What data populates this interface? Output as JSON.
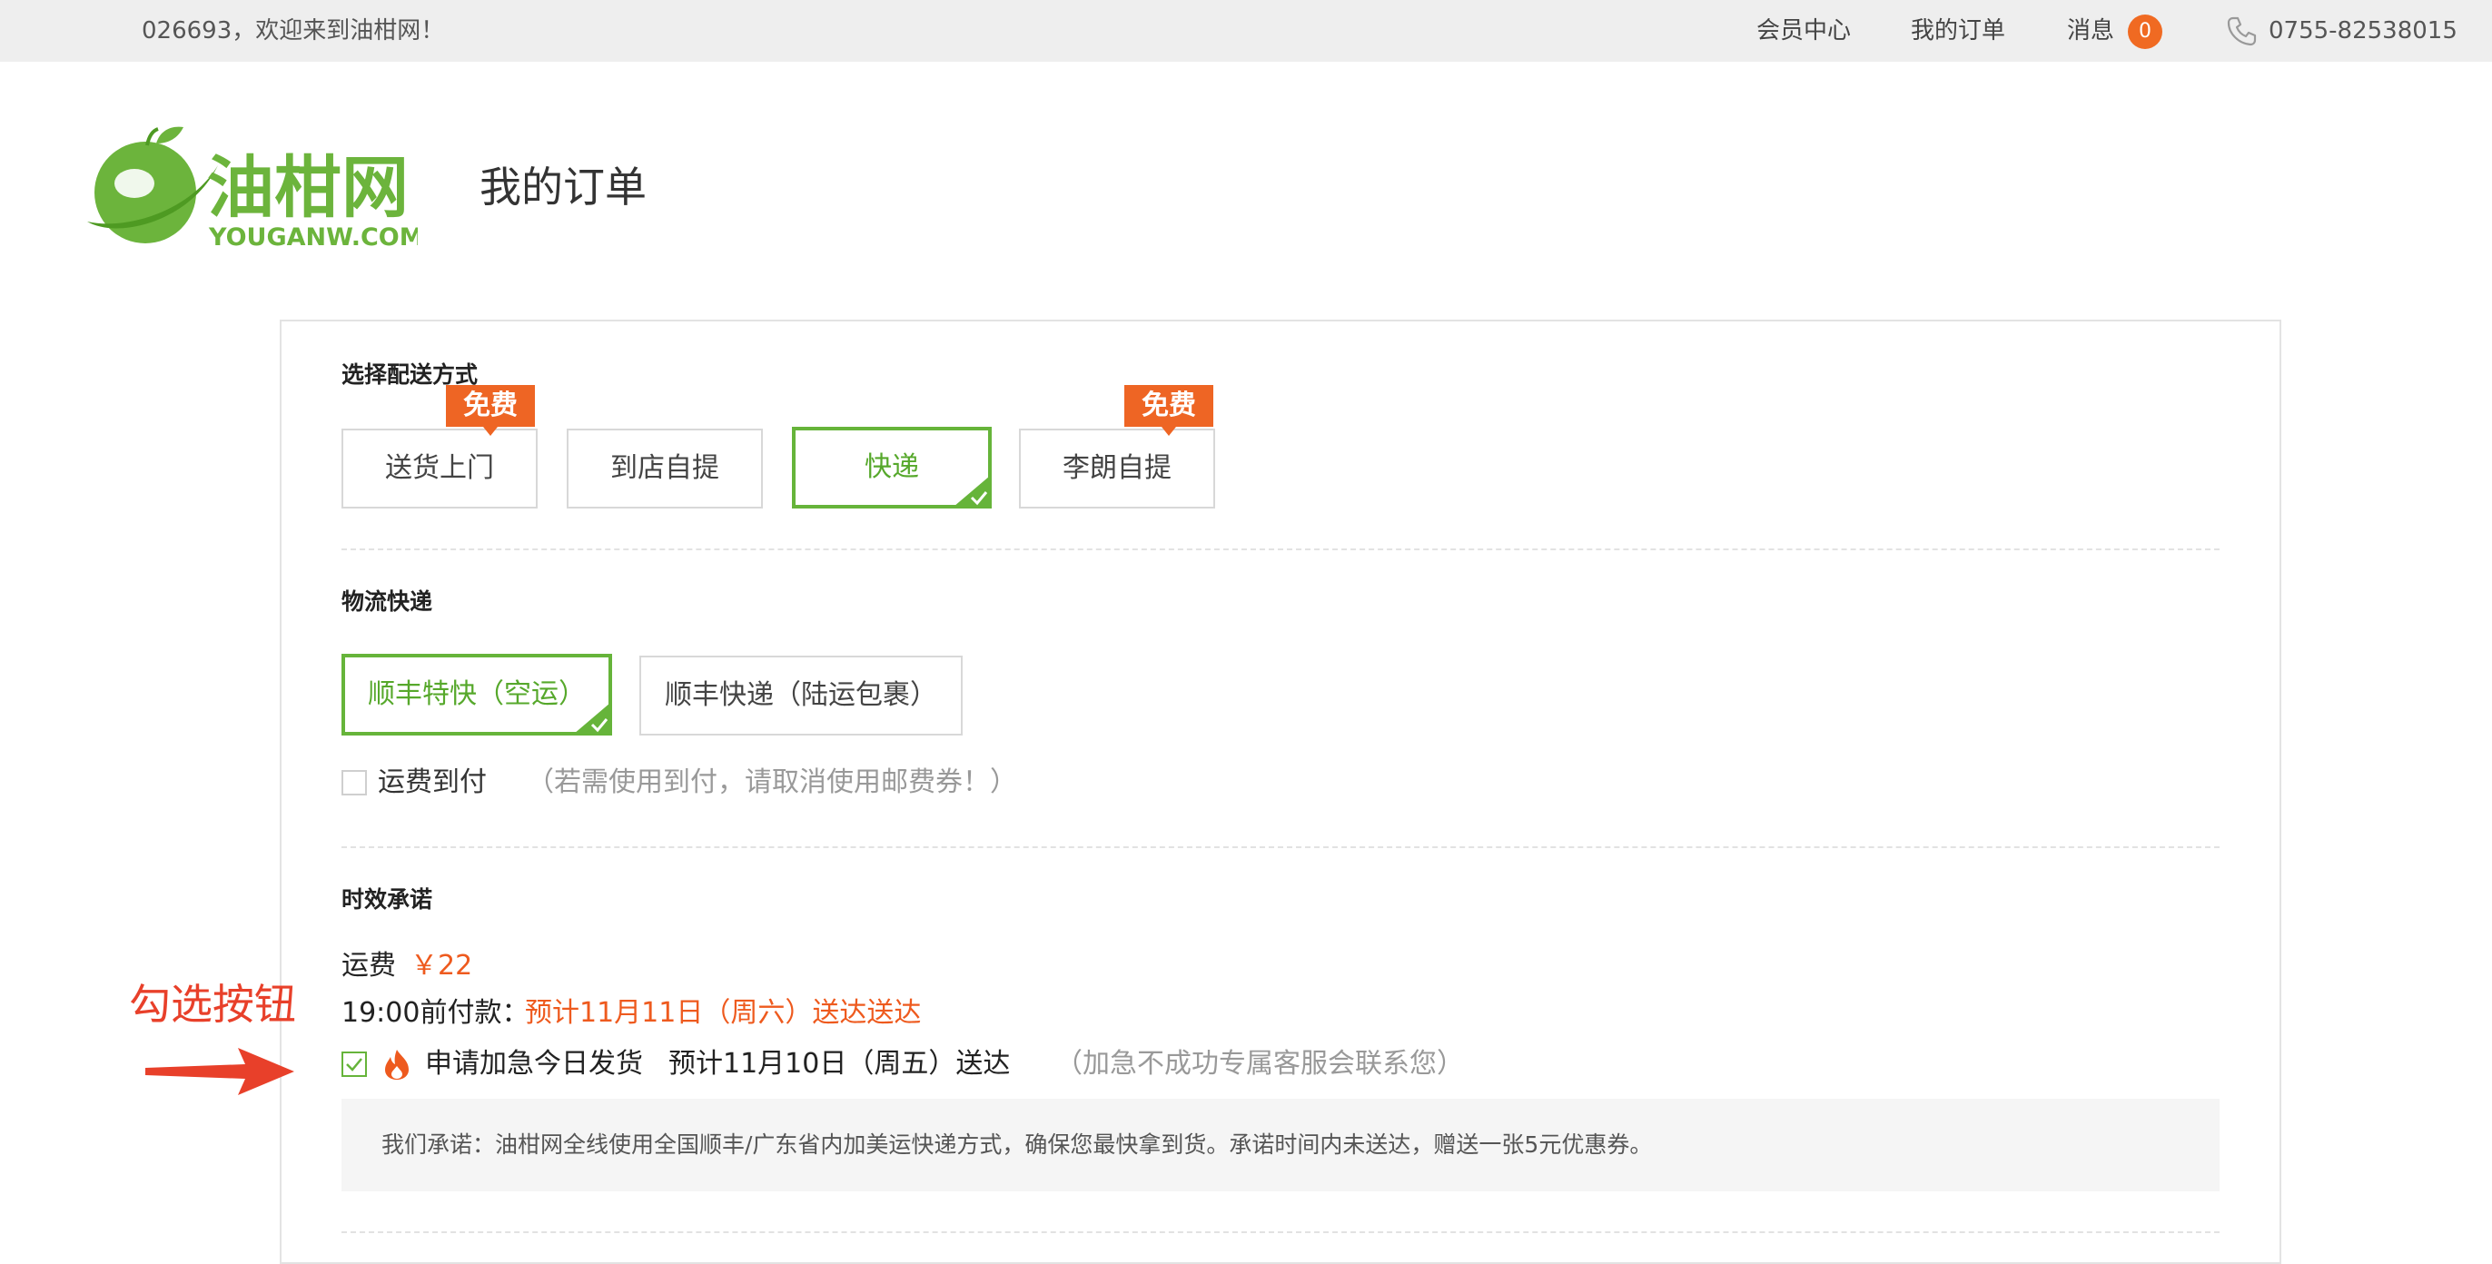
{
  "topbar": {
    "welcome": "026693，欢迎来到油柑网！",
    "member_center": "会员中心",
    "my_orders": "我的订单",
    "messages": "消息",
    "message_count": "0",
    "phone": "0755-82538015",
    "phone_icon": "phone-icon"
  },
  "logo": {
    "name": "油柑网",
    "domain": "YOUGANW.COM"
  },
  "page_title": "我的订单",
  "delivery": {
    "title": "选择配送方式",
    "free_tag": "免费",
    "options": [
      {
        "label": "送货上门",
        "free": true,
        "selected": false
      },
      {
        "label": "到店自提",
        "free": false,
        "selected": false
      },
      {
        "label": "快递",
        "free": false,
        "selected": true
      },
      {
        "label": "李朗自提",
        "free": true,
        "selected": false
      }
    ]
  },
  "logistics": {
    "title": "物流快递",
    "options": [
      {
        "label": "顺丰特快（空运）",
        "selected": true
      },
      {
        "label": "顺丰快递（陆运包裹）",
        "selected": false
      }
    ],
    "cod_label": "运费到付",
    "cod_checked": false,
    "cod_note": "（若需使用到付，请取消使用邮费券！）"
  },
  "timeliness": {
    "title": "时效承诺",
    "fee_label": "运费",
    "fee_value": "￥22",
    "deadline_label": "19:00前付款：",
    "deadline_value": "预计11月11日（周六）送达送达",
    "urgent_checked": true,
    "urgent_icon": "fire-icon",
    "urgent_label": "申请加急今日发货",
    "urgent_eta": "预计11月10日（周五）送达",
    "urgent_note": "（加急不成功专属客服会联系您）",
    "promise": "我们承诺：油柑网全线使用全国顺丰/广东省内加美运快递方式，确保您最快拿到货。承诺时间内未送达，赠送一张5元优惠券。"
  },
  "annotation": {
    "text": "勾选按钮"
  },
  "colors": {
    "accent_green": "#66b43a",
    "accent_orange": "#ee6524",
    "annotation_red": "#e8402a"
  }
}
